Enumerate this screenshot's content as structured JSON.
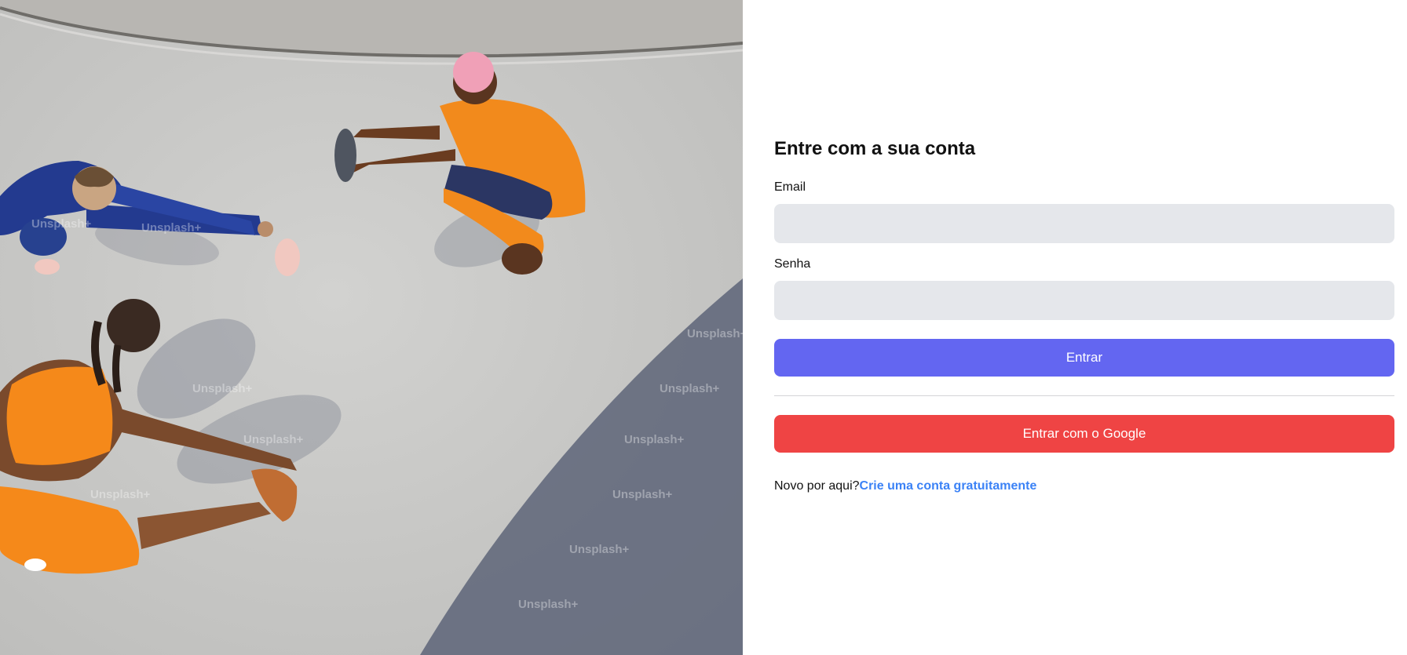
{
  "hero": {
    "image": "Three people stretching on a concrete floor, seen from above",
    "watermark": "Unsplash+"
  },
  "login": {
    "title": "Entre com a sua conta",
    "email_label": "Email",
    "email_value": "",
    "password_label": "Senha",
    "password_value": "",
    "submit_label": "Entrar",
    "google_label": "Entrar com o Google",
    "signup_prompt": "Novo por aqui?",
    "signup_link": "Crie uma conta gratuitamente"
  },
  "colors": {
    "primary": "#6366f1",
    "google": "#ef4444",
    "link": "#3b82f6",
    "input_bg": "#e5e7eb"
  }
}
